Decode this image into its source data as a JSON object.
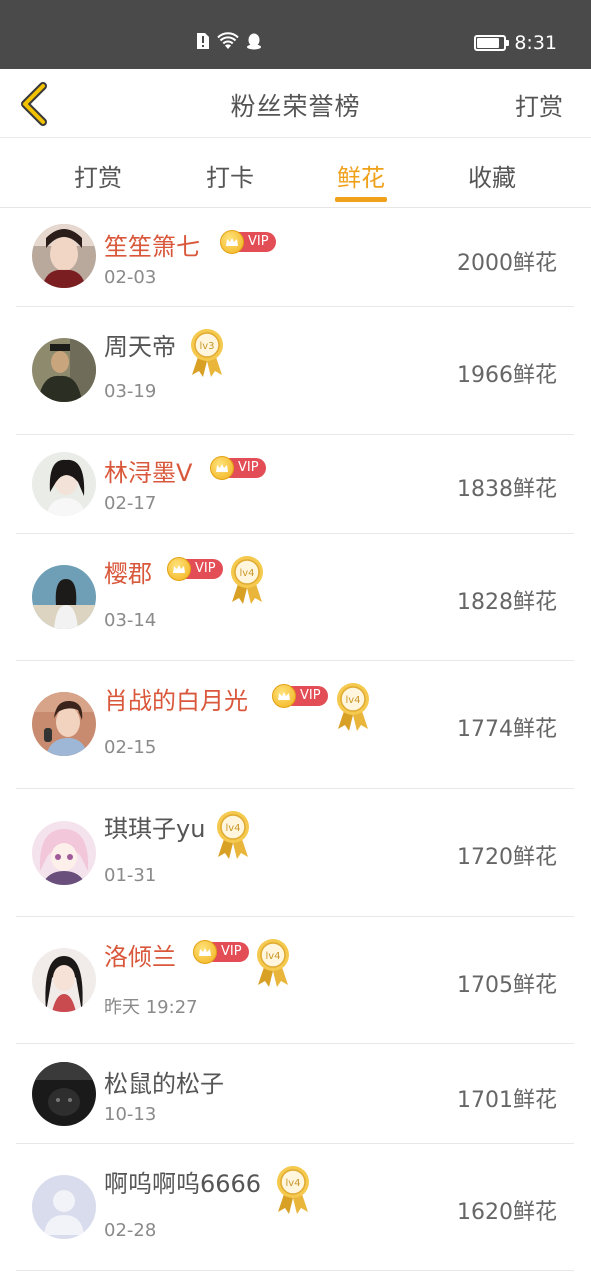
{
  "status_bar": {
    "time": "8:31",
    "battery_level": 0.85
  },
  "header": {
    "title": "粉丝荣誉榜",
    "action_label": "打赏",
    "accent_color": "#f0a11c"
  },
  "tabs": [
    {
      "label": "打赏",
      "active": false
    },
    {
      "label": "打卡",
      "active": false
    },
    {
      "label": "鲜花",
      "active": true
    },
    {
      "label": "收藏",
      "active": false
    }
  ],
  "badges": {
    "vip_label": "VIP",
    "level_prefix": "lv"
  },
  "fans": [
    {
      "name": "笙笙箫七",
      "date": "02-03",
      "score": "2000鲜花",
      "vip": true,
      "level": null
    },
    {
      "name": "周天帝",
      "date": "03-19",
      "score": "1966鲜花",
      "vip": false,
      "level": "lv3"
    },
    {
      "name": "林浔墨V",
      "date": "02-17",
      "score": "1838鲜花",
      "vip": true,
      "level": null
    },
    {
      "name": "樱郡",
      "date": "03-14",
      "score": "1828鲜花",
      "vip": true,
      "level": "lv4"
    },
    {
      "name": "肖战的白月光",
      "date": "02-15",
      "score": "1774鲜花",
      "vip": true,
      "level": "lv4"
    },
    {
      "name": "琪琪子yu",
      "date": "01-31",
      "score": "1720鲜花",
      "vip": false,
      "level": "lv4"
    },
    {
      "name": "洛倾兰",
      "date": "昨天 19:27",
      "score": "1705鲜花",
      "vip": true,
      "level": "lv4"
    },
    {
      "name": "松鼠的松子",
      "date": "10-13",
      "score": "1701鲜花",
      "vip": false,
      "level": null
    },
    {
      "name": "啊呜啊呜6666",
      "date": "02-28",
      "score": "1620鲜花",
      "vip": false,
      "level": "lv4"
    }
  ]
}
